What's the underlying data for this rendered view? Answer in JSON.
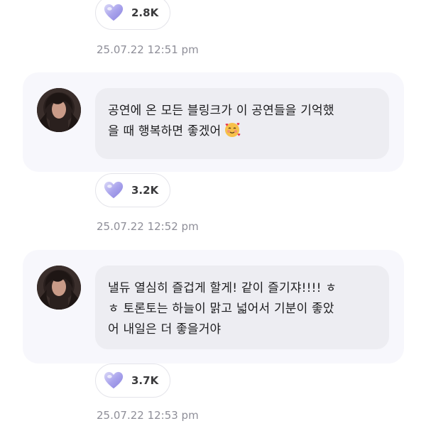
{
  "posts": [
    {
      "likes": "2.8K",
      "timestamp": "25.07.22 12:51 pm"
    },
    {
      "message": "공연에 온 모든 블링크가 이 공연들을 기억했\n을 때 행복하면 좋겠어",
      "emoji": "smiling-face-with-hearts-icon",
      "likes": "3.2K",
      "timestamp": "25.07.22 12:52 pm"
    },
    {
      "message": "낼듀 열심히 즐겁게 할게! 같이 즐기쟈!!!! ㅎ\nㅎ 토론토는 하늘이 맑고 넓어서 기분이 좋았\n어 내일은 더 좋을거야",
      "likes": "3.7K",
      "timestamp": "25.07.22 12:53 pm"
    }
  ],
  "icons": {
    "reaction": "heart-icon",
    "avatar": "avatar"
  },
  "colors": {
    "card_background": "#f7f7fc",
    "bubble_background": "#ededf2",
    "heart": "#b8b4f0",
    "timestamp": "#8e8e98"
  }
}
